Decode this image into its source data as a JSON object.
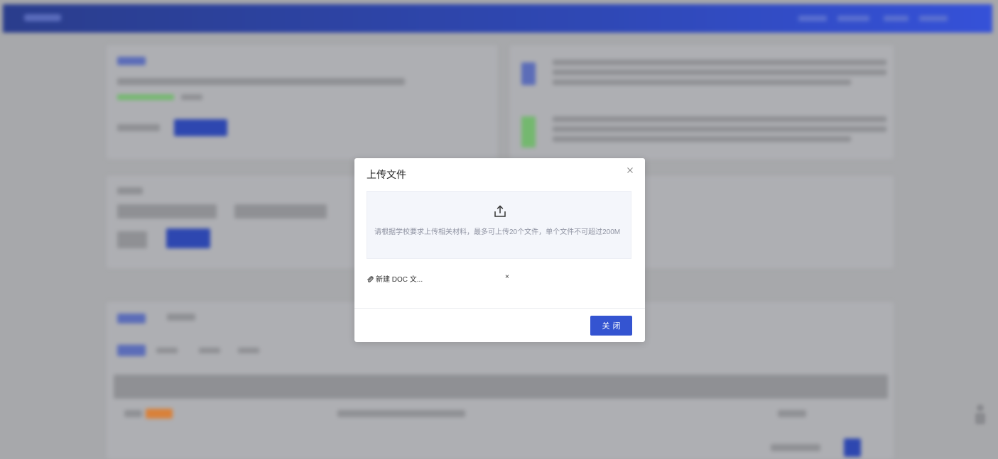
{
  "modal": {
    "title": "上传文件",
    "close_icon": "close-icon",
    "dropzone": {
      "icon": "upload-icon",
      "hint": "请根据学校要求上传相关材料，最多可上传20个文件，单个文件不可超过200M"
    },
    "files": [
      {
        "icon": "paperclip-icon",
        "name": "新建 DOC 文...",
        "remove_label": "×"
      }
    ],
    "footer": {
      "close_label": "关闭"
    }
  },
  "colors": {
    "primary": "#3454d1",
    "header_gradient_start": "#2a3d8c",
    "header_gradient_end": "#3551d8",
    "overlay": "#a7a8ab",
    "dropzone_bg": "#f4f6fb"
  }
}
